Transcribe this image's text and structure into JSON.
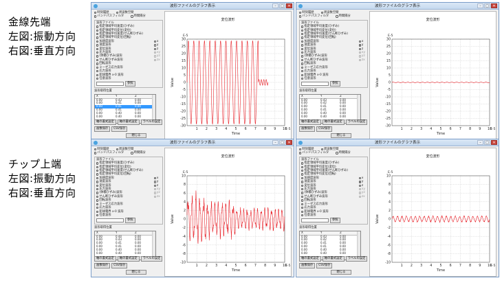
{
  "captions": {
    "top": [
      "金線先端",
      "左図:振動方向",
      "右図:垂直方向"
    ],
    "bottom": [
      "チップ上端",
      "左図:振動方向",
      "右図:垂直方向"
    ]
  },
  "window": {
    "title": "波形ファイルのグラフ表示",
    "icon_name": "app-icon",
    "min_label": "–",
    "max_label": "□",
    "close_label": "✕",
    "radio_time": "時刻履歴",
    "radio_freq": "周波数空間",
    "radio_bandpass": "バンドパスフィルタ",
    "radio_timelimit": "時間隔分",
    "group_label": "波形ファイル",
    "files": [
      "指定領域平均速度(ひずみ)",
      "指定領域平均変位(変位)",
      "指定領域平均速度(せん断ひずみ)",
      "指定領域平均変位(回転)",
      "加速度波形",
      "速度波形",
      "変位波形",
      "圧力波形",
      "(体積ひずみ)波形",
      "せん断ひずみ波形",
      "回転波形",
      "ミーゼス応力波形",
      "応力波形",
      "鉛球電界 x-0 波形",
      "任意波形"
    ],
    "axis_options": [
      "x",
      "y",
      "z",
      "xy",
      "yz",
      "zx"
    ],
    "ref_button": "参照",
    "pos_label": "波形取得位置",
    "table_headers": [
      "X",
      "Y",
      "Z"
    ],
    "bottom_buttons": [
      "軸の書式設定",
      "軸の書式設定",
      "ラベルの設定",
      "画像保存",
      "CSV保存"
    ],
    "close_button": "閉じる",
    "plot_title": "変位波形",
    "y_label": "Value",
    "x_label": "Time",
    "y_exp": "E-5",
    "x_exp": "E-5"
  },
  "windows": [
    {
      "id": "top-left",
      "table_rows": [
        [
          "0.00",
          "0.43",
          "0.00"
        ],
        [
          "0.00",
          "0.41",
          "0.00"
        ],
        [
          "0.00",
          "0.41",
          "0.00"
        ],
        [
          "0.00",
          "0.41",
          "0.00"
        ],
        [
          "0.00",
          "0.40",
          "0.00"
        ],
        [
          "0.00",
          "0.40",
          "0.00"
        ]
      ],
      "selected_row": 2
    },
    {
      "id": "top-right",
      "table_rows": [
        [
          "0.00",
          "0.43",
          "0.00"
        ],
        [
          "0.00",
          "0.42",
          "0.00"
        ],
        [
          "0.00",
          "0.41",
          "0.00"
        ],
        [
          "0.00",
          "0.41",
          "0.00"
        ],
        [
          "0.00",
          "0.40",
          "0.00"
        ],
        [
          "0.00",
          "0.40",
          "0.00"
        ]
      ],
      "selected_row": -1
    },
    {
      "id": "bottom-left",
      "table_rows": [
        [
          "0.00",
          "0.44",
          "0.00"
        ],
        [
          "0.00",
          "0.43",
          "0.00"
        ],
        [
          "0.00",
          "0.41",
          "0.00"
        ],
        [
          "0.00",
          "0.41",
          "0.00"
        ],
        [
          "0.00",
          "0.40",
          "0.00"
        ],
        [
          "0.00",
          "0.40",
          "0.00"
        ]
      ],
      "selected_row": -1
    },
    {
      "id": "bottom-right",
      "table_rows": [
        [
          "0.00",
          "0.43",
          "0.00"
        ],
        [
          "0.00",
          "0.42",
          "0.00"
        ],
        [
          "0.00",
          "0.41",
          "0.00"
        ],
        [
          "0.00",
          "0.41",
          "0.00"
        ],
        [
          "0.00",
          "0.40",
          "0.00"
        ],
        [
          "0.00",
          "0.40",
          "0.00"
        ]
      ],
      "selected_row": -1
    }
  ],
  "chart_data": [
    {
      "type": "line",
      "title": "変位波形",
      "xlabel": "Time",
      "ylabel": "Value",
      "x_exponent": "E-5",
      "y_exponent": "E-5",
      "xlim": [
        0,
        10
      ],
      "ylim": [
        -30,
        30
      ],
      "x_ticks": [
        1,
        2,
        3,
        4,
        5,
        6,
        7,
        8,
        9,
        10
      ],
      "y_ticks": [
        -30,
        -25,
        -20,
        -15,
        -10,
        -5,
        0,
        5,
        10,
        15,
        20,
        25,
        30
      ],
      "series": [
        {
          "color": "#e8232a",
          "amplitude_segments": [
            {
              "x_start": 0.0,
              "x_end": 7.3,
              "amplitude": 29,
              "cycles": 13.3
            },
            {
              "x_start": 7.3,
              "x_end": 8.3,
              "amplitude": 2,
              "cycles": 4
            }
          ]
        }
      ]
    },
    {
      "type": "line",
      "title": "変位波形",
      "xlabel": "Time",
      "ylabel": "Value",
      "x_exponent": "E-5",
      "y_exponent": "E-5",
      "xlim": [
        0,
        10
      ],
      "ylim": [
        -30,
        30
      ],
      "x_ticks": [
        1,
        2,
        3,
        4,
        5,
        6,
        7,
        8,
        9,
        10
      ],
      "y_ticks": [
        -30,
        -25,
        -20,
        -15,
        -10,
        -5,
        0,
        5,
        10,
        15,
        20,
        25,
        30
      ],
      "series": [
        {
          "color": "#e8232a",
          "amplitude_segments": [
            {
              "x_start": 0.0,
              "x_end": 10.0,
              "amplitude": 0.3,
              "cycles": 20
            }
          ]
        }
      ]
    },
    {
      "type": "line",
      "title": "変位波形",
      "xlabel": "Time",
      "ylabel": "Value",
      "x_exponent": "E-5",
      "y_exponent": "E-5",
      "xlim": [
        0,
        10
      ],
      "ylim": [
        -10,
        10
      ],
      "x_ticks": [
        1,
        2,
        3,
        4,
        5,
        6,
        7,
        8,
        9,
        10
      ],
      "y_ticks": [
        -10,
        -8,
        -6,
        -4,
        -2,
        0,
        2,
        4,
        6,
        8,
        10
      ],
      "series": [
        {
          "color": "#e8232a",
          "amplitude_segments": [
            {
              "x_start": 0.0,
              "x_end": 2.0,
              "amplitude": 5.5,
              "cycles": 5
            },
            {
              "x_start": 2.0,
              "x_end": 5.0,
              "amplitude": 4,
              "cycles": 8
            },
            {
              "x_start": 5.0,
              "x_end": 10.0,
              "amplitude": 2.5,
              "cycles": 14
            }
          ]
        }
      ]
    },
    {
      "type": "line",
      "title": "変位波形",
      "xlabel": "Time",
      "ylabel": "Value",
      "x_exponent": "E-5",
      "y_exponent": "E-5",
      "xlim": [
        0,
        10
      ],
      "ylim": [
        -10,
        10
      ],
      "x_ticks": [
        1,
        2,
        3,
        4,
        5,
        6,
        7,
        8,
        9,
        10
      ],
      "y_ticks": [
        -10,
        -8,
        -6,
        -4,
        -2,
        0,
        2,
        4,
        6,
        8,
        10
      ],
      "series": [
        {
          "color": "#e8232a",
          "amplitude_segments": [
            {
              "x_start": 0.0,
              "x_end": 10.0,
              "amplitude": 0.8,
              "cycles": 22
            }
          ]
        }
      ]
    }
  ]
}
